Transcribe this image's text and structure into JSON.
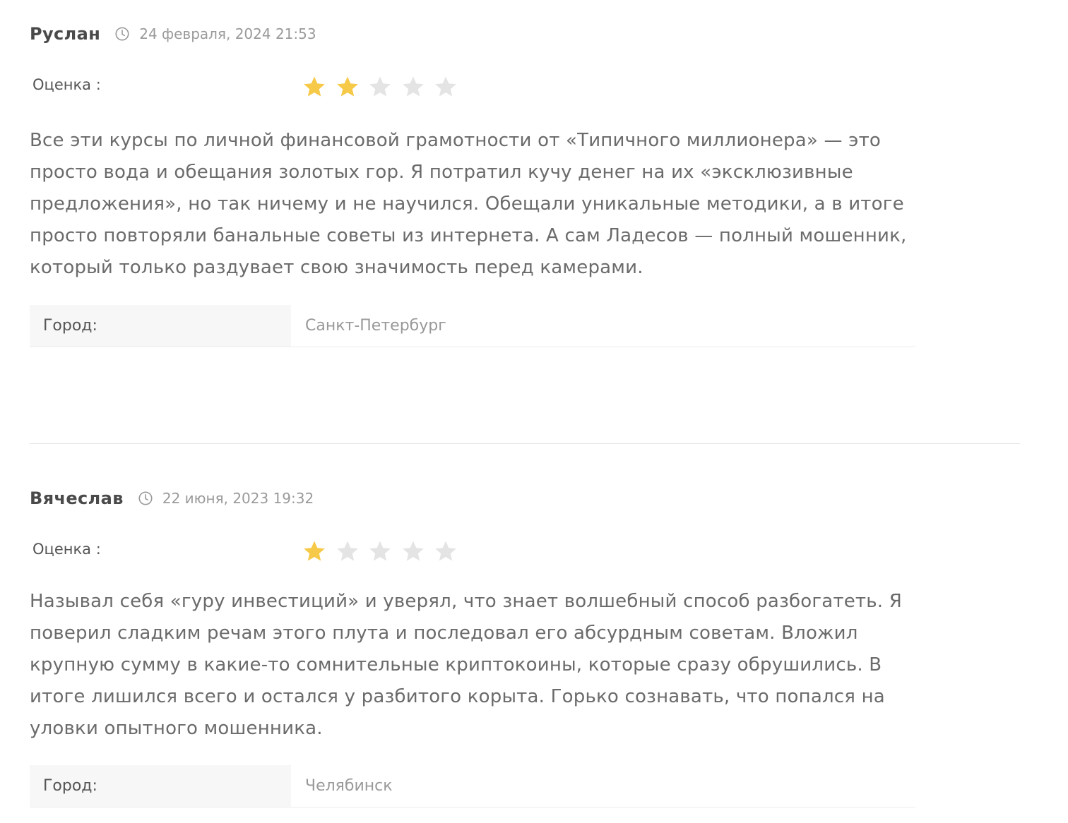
{
  "colors": {
    "star_filled": "#F7C948",
    "star_empty": "#E4E4E4"
  },
  "reviews": [
    {
      "author": "Руслан",
      "date": "24 февраля, 2024 21:53",
      "rating_label": "Оценка :",
      "rating": 2,
      "rating_max": 5,
      "text": "Все эти курсы по личной финансовой грамотности от «Типичного миллионера» — это просто вода и обещания золотых гор. Я потратил кучу денег на их «эксклюзивные предложения», но так ничему и не научился. Обещали уникальные методики, а в итоге просто повторяли банальные советы из интернета. А сам Ладесов — полный мошенник, который только раздувает свою значимость перед камерами.",
      "city_label": "Город:",
      "city": "Санкт-Петербург"
    },
    {
      "author": "Вячеслав",
      "date": "22 июня, 2023 19:32",
      "rating_label": "Оценка :",
      "rating": 1,
      "rating_max": 5,
      "text": "Называл себя «гуру инвестиций» и уверял, что знает волшебный способ разбогатеть. Я поверил сладким речам этого плута и последовал его абсурдным советам. Вложил крупную сумму в какие-то сомнительные криптокоины, которые сразу обрушились. В итоге лишился всего и остался у разбитого корыта. Горько сознавать, что попался на уловки опытного мошенника.",
      "city_label": "Город:",
      "city": "Челябинск"
    }
  ]
}
